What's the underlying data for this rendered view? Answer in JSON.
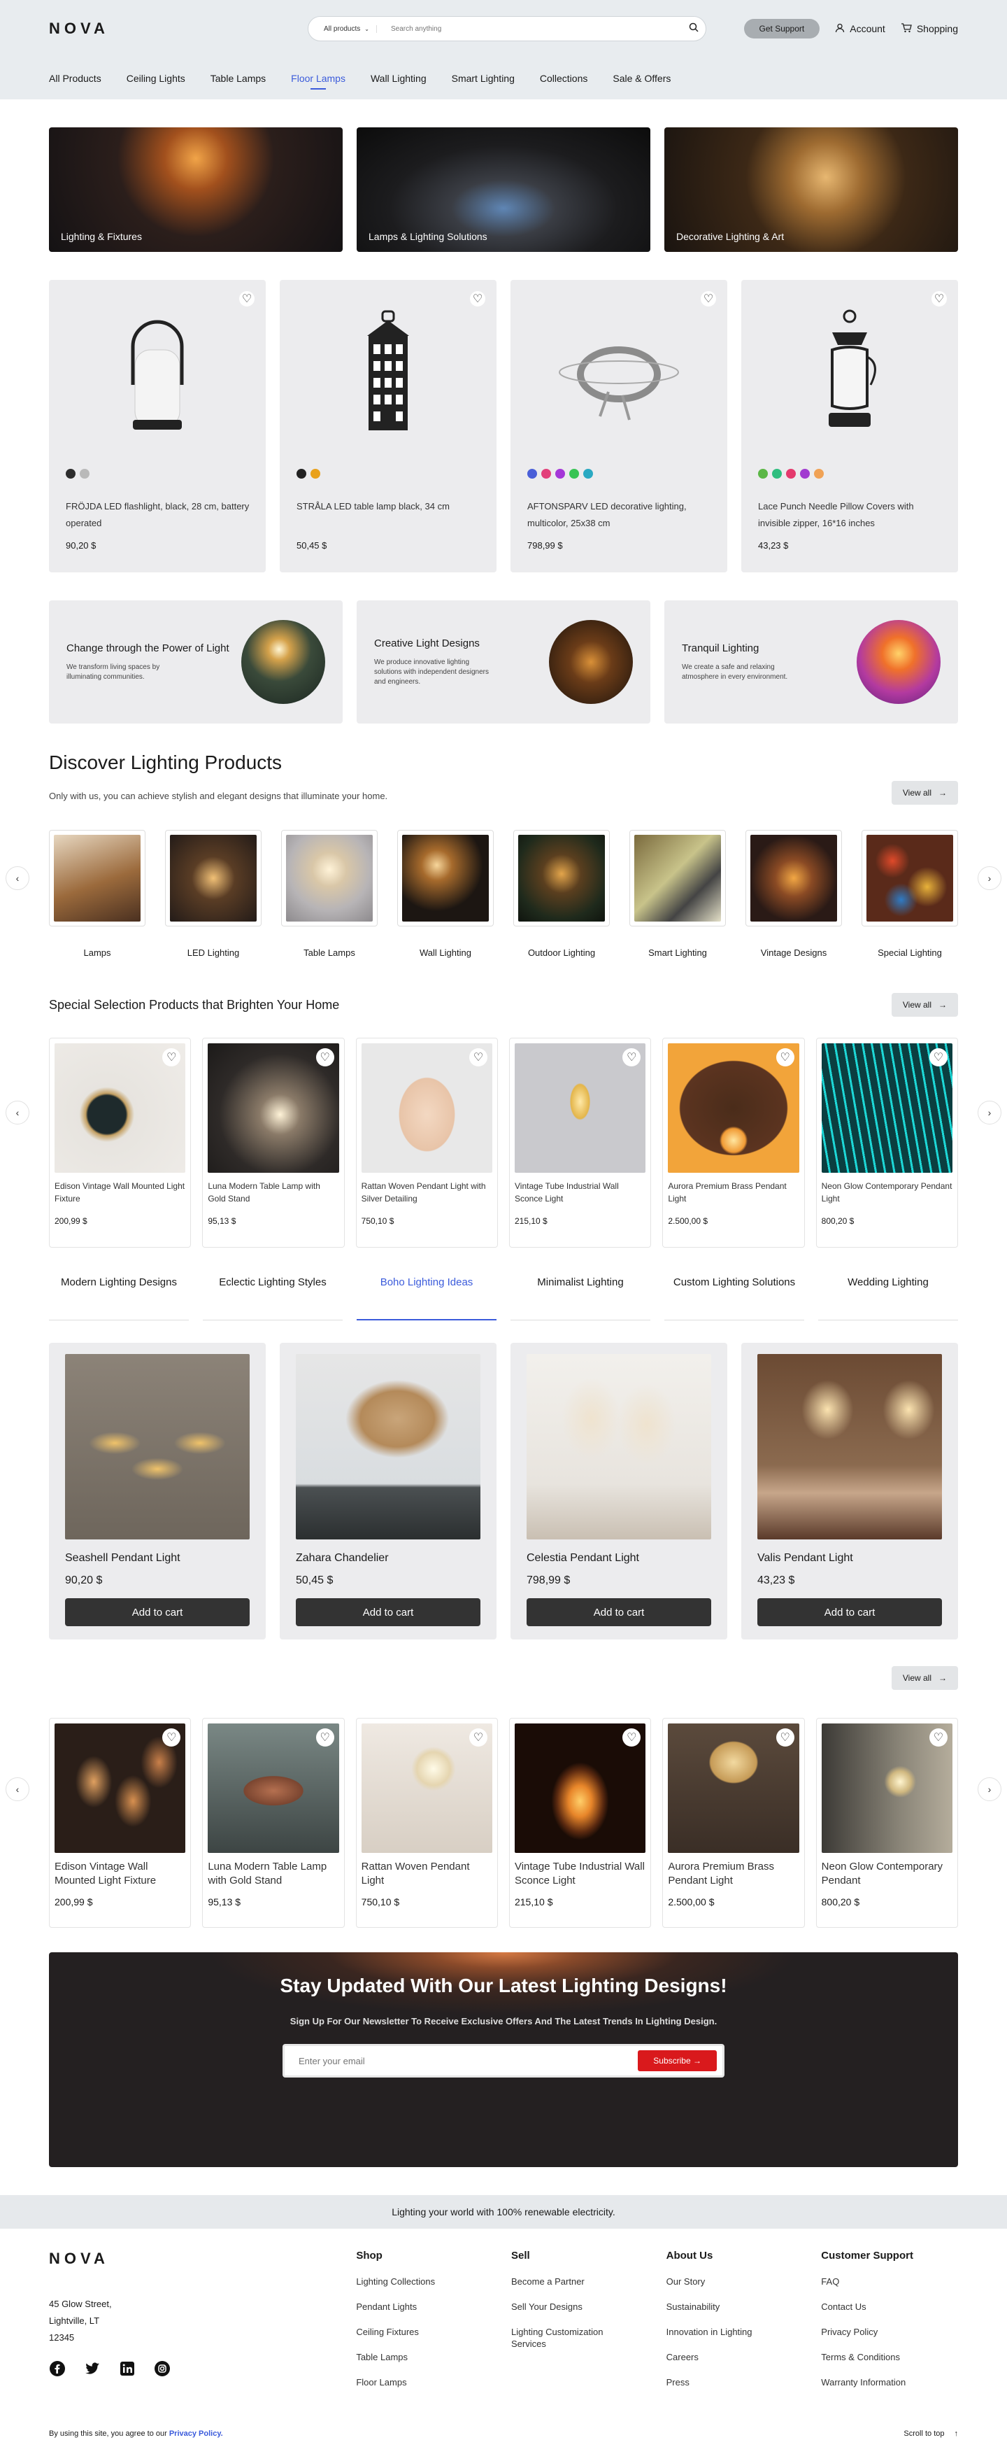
{
  "brand": "NOVA",
  "header": {
    "search_category": "All products",
    "search_placeholder": "Search anything",
    "support_label": "Get Support",
    "account_label": "Account",
    "shopping_label": "Shopping"
  },
  "nav": [
    "All Products",
    "Ceiling Lights",
    "Table Lamps",
    "Floor Lamps",
    "Wall Lighting",
    "Smart Lighting",
    "Collections",
    "Sale & Offers"
  ],
  "hero": [
    "Lighting & Fixtures",
    "Lamps & Lighting Solutions",
    "Decorative Lighting & Art"
  ],
  "featured": [
    {
      "name": "FRÖJDA LED flashlight, black, 28 cm, battery operated",
      "price": "90,20 $",
      "dots": [
        "#2d2d2d",
        "#b9b9b9"
      ]
    },
    {
      "name": "STRÅLA LED table lamp black, 34 cm",
      "price": "50,45 $",
      "dots": [
        "#222222",
        "#e9a11b"
      ]
    },
    {
      "name": "AFTONSPARV LED decorative lighting, multicolor, 25x38 cm",
      "price": "798,99 $",
      "dots": [
        "#4a5fd8",
        "#e2407a",
        "#a537d8",
        "#38c454",
        "#2aa9c2"
      ]
    },
    {
      "name": "Lace Punch Needle Pillow Covers with invisible zipper, 16*16 inches",
      "price": "43,23 $",
      "dots": [
        "#5bb746",
        "#2fbe7f",
        "#e43a6d",
        "#a13bd0",
        "#f0a255"
      ]
    }
  ],
  "promos": [
    {
      "title": "Change through the Power of Light",
      "text": "We transform living spaces by illuminating communities."
    },
    {
      "title": "Creative Light Designs",
      "text": "We produce innovative lighting solutions with independent designers and engineers."
    },
    {
      "title": "Tranquil Lighting",
      "text": "We create a safe and relaxing atmosphere in every environment."
    }
  ],
  "discover": {
    "title": "Discover Lighting Products",
    "subtitle": "Only with us, you can achieve stylish and elegant designs that illuminate your home.",
    "view_all": "View all",
    "categories": [
      "Lamps",
      "LED Lighting",
      "Table Lamps",
      "Wall Lighting",
      "Outdoor Lighting",
      "Smart Lighting",
      "Vintage Designs",
      "Special Lighting"
    ]
  },
  "special": {
    "title": "Special Selection Products that Brighten Your Home",
    "view_all": "View all",
    "items": [
      {
        "name": "Edison Vintage Wall Mounted Light Fixture",
        "price": "200,99 $"
      },
      {
        "name": "Luna Modern Table Lamp with Gold Stand",
        "price": "95,13 $"
      },
      {
        "name": "Rattan Woven Pendant Light with Silver Detailing",
        "price": "750,10 $"
      },
      {
        "name": "Vintage Tube Industrial Wall Sconce Light",
        "price": "215,10 $"
      },
      {
        "name": "Aurora Premium Brass Pendant Light",
        "price": "2.500,00 $"
      },
      {
        "name": "Neon Glow Contemporary Pendant Light",
        "price": "800,20 $"
      }
    ]
  },
  "tabs": [
    "Modern Lighting Designs",
    "Eclectic Lighting Styles",
    "Boho Lighting Ideas",
    "Minimalist Lighting",
    "Custom Lighting Solutions",
    "Wedding Lighting"
  ],
  "boho": {
    "add_label": "Add to cart",
    "items": [
      {
        "name": "Seashell Pendant Light",
        "price": "90,20 $"
      },
      {
        "name": "Zahara Chandelier",
        "price": "50,45 $"
      },
      {
        "name": "Celestia Pendant Light",
        "price": "798,99 $"
      },
      {
        "name": "Valis Pendant Light",
        "price": "43,23 $"
      }
    ]
  },
  "more": {
    "view_all": "View all",
    "items": [
      {
        "name": "Edison Vintage Wall Mounted Light Fixture",
        "price": "200,99 $"
      },
      {
        "name": "Luna Modern Table Lamp with Gold Stand",
        "price": "95,13 $"
      },
      {
        "name": "Rattan Woven Pendant Light",
        "price": "750,10 $"
      },
      {
        "name": "Vintage Tube Industrial Wall Sconce Light",
        "price": "215,10 $"
      },
      {
        "name": "Aurora Premium Brass Pendant Light",
        "price": "2.500,00 $"
      },
      {
        "name": "Neon Glow Contemporary Pendant",
        "price": "800,20 $"
      }
    ]
  },
  "newsletter": {
    "title": "Stay Updated With Our Latest Lighting Designs!",
    "text": "Sign Up For Our Newsletter To Receive Exclusive Offers And The Latest Trends In Lighting Design.",
    "placeholder": "Enter your email",
    "button": "Subscribe"
  },
  "eco_banner": "Lighting your world with 100% renewable electricity.",
  "footer": {
    "address": [
      "45 Glow Street,",
      "Lightville, LT",
      "12345"
    ],
    "columns": [
      {
        "title": "Shop",
        "links": [
          "Lighting Collections",
          "Pendant Lights",
          "Ceiling Fixtures",
          "Table Lamps",
          "Floor Lamps"
        ]
      },
      {
        "title": "Sell",
        "links": [
          "Become a Partner",
          "Sell Your Designs",
          "Lighting Customization Services"
        ]
      },
      {
        "title": "About Us",
        "links": [
          "Our Story",
          "Sustainability",
          "Innovation in Lighting",
          "Careers",
          "Press"
        ]
      },
      {
        "title": "Customer Support",
        "links": [
          "FAQ",
          "Contact Us",
          "Privacy Policy",
          "Terms & Conditions",
          "Warranty Information"
        ]
      }
    ],
    "legal_text": "By using this site, you agree to our",
    "legal_link": "Privacy Policy.",
    "scroll_top": "Scroll to top"
  },
  "colors": {
    "accent": "#3b5bdb",
    "subscribe": "#d9191c",
    "dark_button": "#333333"
  }
}
